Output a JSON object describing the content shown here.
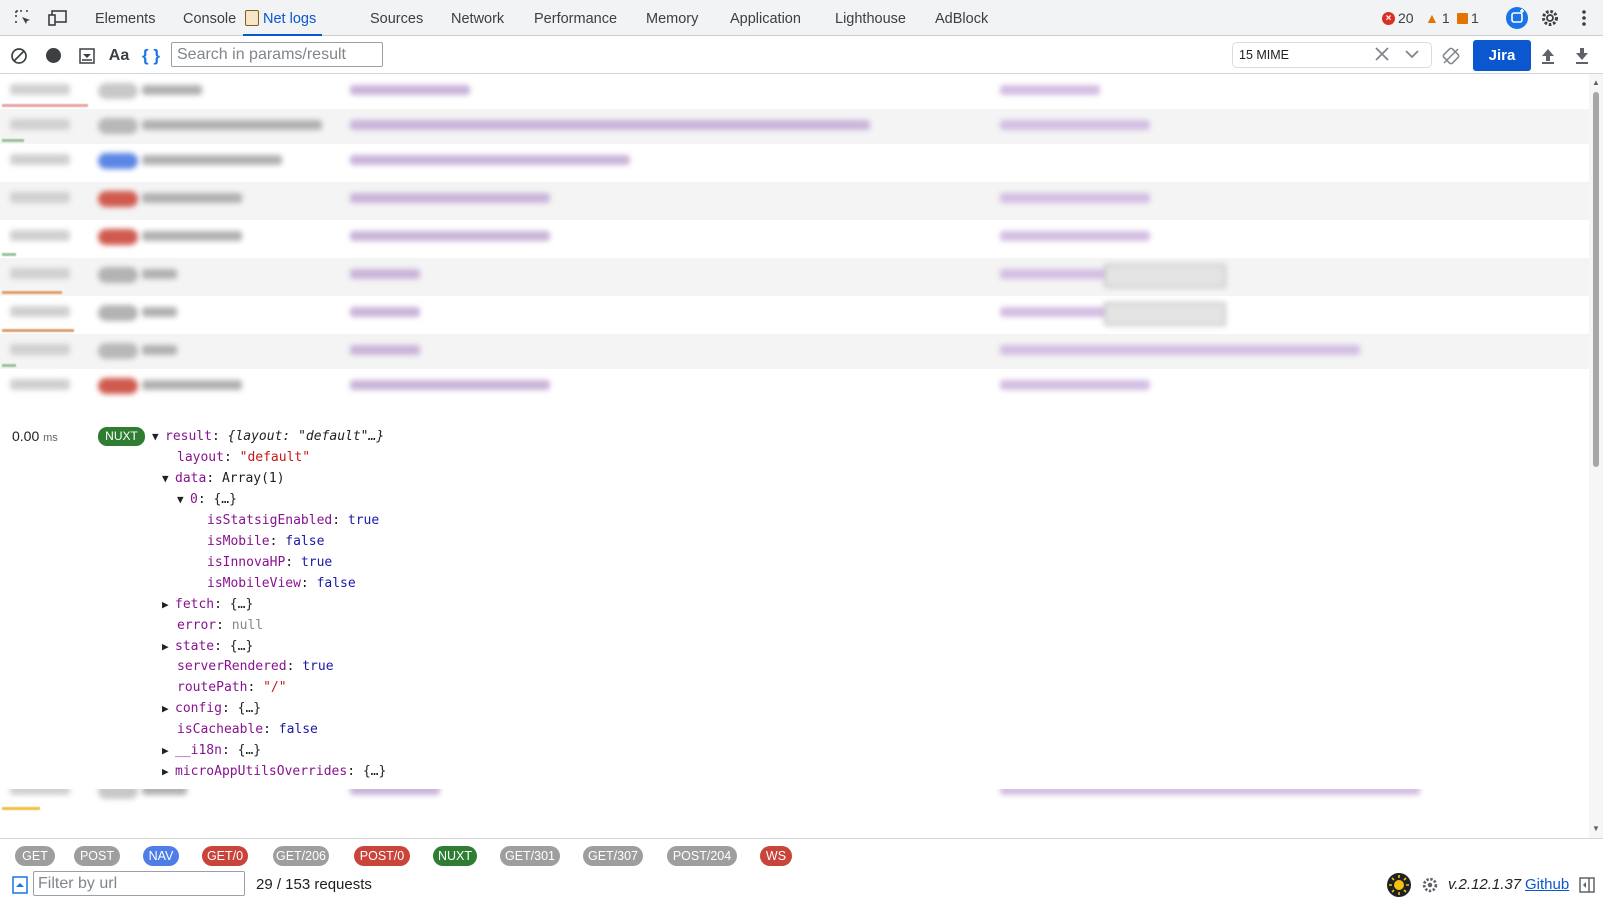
{
  "devtools_tabs": [
    "Elements",
    "Console",
    "Net logs",
    "Sources",
    "Network",
    "Performance",
    "Memory",
    "Application",
    "Lighthouse",
    "AdBlock"
  ],
  "active_tab": "Net logs",
  "counts": {
    "errors": "20",
    "warnings": "1",
    "issues": "1"
  },
  "toolbar": {
    "case_label": "Aa",
    "braces_label": "{ }",
    "search_placeholder": "Search in params/result",
    "mime_value": "15 MIME",
    "jira_label": "Jira"
  },
  "colors": {
    "accent": "#0b57d0",
    "get": "#9e9e9e",
    "nav": "#4f7de8",
    "error": "#c9443a",
    "nuxt": "#2e7d32"
  },
  "detail": {
    "time": "0.00",
    "unit": "ms",
    "badge": "NUXT",
    "lines": [
      {
        "indent": 0,
        "toggle": "open",
        "key": "result",
        "punct": ": ",
        "value": "{layout: \"default\"…}",
        "vtype": "summary"
      },
      {
        "indent": 1,
        "toggle": "",
        "key": "layout",
        "punct": ": ",
        "value": "\"default\"",
        "vtype": "str"
      },
      {
        "indent": 1,
        "toggle": "open",
        "key": "data",
        "punct": ": ",
        "value": "Array(1)",
        "vtype": "plain"
      },
      {
        "indent": 2,
        "toggle": "open",
        "key": "0",
        "punct": ": ",
        "value": "{…}",
        "vtype": "plain"
      },
      {
        "indent": 3,
        "toggle": "",
        "key": "isStatsigEnabled",
        "punct": ": ",
        "value": "true",
        "vtype": "bool"
      },
      {
        "indent": 3,
        "toggle": "",
        "key": "isMobile",
        "punct": ": ",
        "value": "false",
        "vtype": "bool"
      },
      {
        "indent": 3,
        "toggle": "",
        "key": "isInnovaHP",
        "punct": ": ",
        "value": "true",
        "vtype": "bool"
      },
      {
        "indent": 3,
        "toggle": "",
        "key": "isMobileView",
        "punct": ": ",
        "value": "false",
        "vtype": "bool"
      },
      {
        "indent": 1,
        "toggle": "closed",
        "key": "fetch",
        "punct": ": ",
        "value": "{…}",
        "vtype": "plain"
      },
      {
        "indent": 1,
        "toggle": "",
        "key": "error",
        "punct": ": ",
        "value": "null",
        "vtype": "nul"
      },
      {
        "indent": 1,
        "toggle": "closed",
        "key": "state",
        "punct": ": ",
        "value": "{…}",
        "vtype": "plain"
      },
      {
        "indent": 1,
        "toggle": "",
        "key": "serverRendered",
        "punct": ": ",
        "value": "true",
        "vtype": "bool"
      },
      {
        "indent": 1,
        "toggle": "",
        "key": "routePath",
        "punct": ": ",
        "value": "\"/\"",
        "vtype": "str"
      },
      {
        "indent": 1,
        "toggle": "closed",
        "key": "config",
        "punct": ": ",
        "value": "{…}",
        "vtype": "plain"
      },
      {
        "indent": 1,
        "toggle": "",
        "key": "isCacheable",
        "punct": ": ",
        "value": "false",
        "vtype": "bool"
      },
      {
        "indent": 1,
        "toggle": "closed",
        "key": "__i18n",
        "punct": ": ",
        "value": "{…}",
        "vtype": "plain"
      },
      {
        "indent": 1,
        "toggle": "closed",
        "key": "microAppUtilsOverrides",
        "punct": ": ",
        "value": "{…}",
        "vtype": "plain"
      }
    ]
  },
  "filters": [
    {
      "label": "GET",
      "color": "#9e9e9e"
    },
    {
      "label": "POST",
      "color": "#9e9e9e"
    },
    {
      "label": "NAV",
      "color": "#4f7de8"
    },
    {
      "label": "GET/0",
      "color": "#c9443a"
    },
    {
      "label": "GET/206",
      "color": "#9e9e9e"
    },
    {
      "label": "POST/0",
      "color": "#c9443a"
    },
    {
      "label": "NUXT",
      "color": "#2e7d32"
    },
    {
      "label": "GET/301",
      "color": "#9e9e9e"
    },
    {
      "label": "GET/307",
      "color": "#9e9e9e"
    },
    {
      "label": "POST/204",
      "color": "#9e9e9e"
    },
    {
      "label": "WS",
      "color": "#c9443a"
    }
  ],
  "status": {
    "url_placeholder": "Filter by url",
    "request_count": "29 / 153 requests",
    "version": "v.2.12.1.37",
    "github_label": "Github"
  }
}
